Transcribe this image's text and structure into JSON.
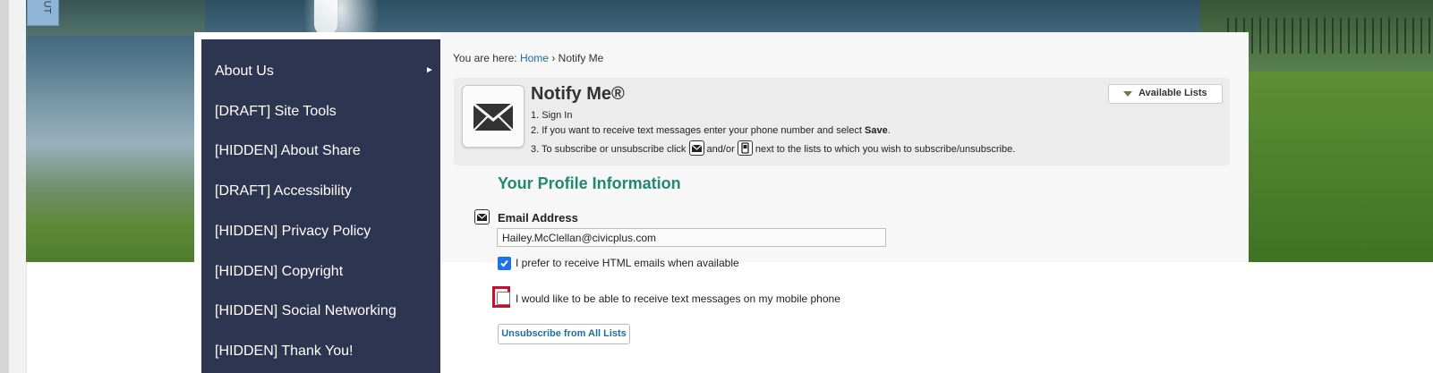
{
  "sidebar": {
    "items": [
      {
        "label": "About Us"
      },
      {
        "label": "[DRAFT] Site Tools"
      },
      {
        "label": "[HIDDEN] About Share"
      },
      {
        "label": "[DRAFT] Accessibility"
      },
      {
        "label": "[HIDDEN] Privacy Policy"
      },
      {
        "label": "[HIDDEN] Copyright"
      },
      {
        "label": "[HIDDEN] Social Networking"
      },
      {
        "label": "[HIDDEN] Thank You!"
      }
    ],
    "submenu_arrow": "►"
  },
  "breadcrumb": {
    "prefix": "You are here:",
    "home": "Home",
    "separator": "›",
    "current": "Notify Me"
  },
  "notify": {
    "title": "Notify Me®",
    "steps": {
      "step1": "1. Sign In",
      "step2_prefix": "2. If you want to receive text messages enter your phone number and select ",
      "step2_bold": "Save",
      "step2_suffix": ".",
      "step3_prefix": "3. To subscribe or unsubscribe click ",
      "step3_middle": " and/or ",
      "step3_suffix": " next to the lists to which you wish to subscribe/unsubscribe."
    },
    "available_lists": "Available Lists",
    "icons": {
      "main": "envelope-icon",
      "email_small": "envelope-icon",
      "sms_small": "mobile-phone-icon"
    }
  },
  "profile": {
    "section_title": "Your Profile Information",
    "email_label": "Email Address",
    "email_value": "Hailey.McClellan@civicplus.com",
    "html_pref_label": "I prefer to receive HTML emails when available",
    "html_pref_checked": true,
    "sms_label": "I would like to be able to receive text messages on my mobile phone",
    "sms_checked": false,
    "unsubscribe_label": "Unsubscribe from All Lists"
  },
  "colors": {
    "sidebar_bg": "#2d3550",
    "accent_green": "#1f8a6e",
    "link_blue": "#1f6f9e",
    "highlight_red": "#c8102e",
    "checkbox_blue": "#1a73e8"
  }
}
